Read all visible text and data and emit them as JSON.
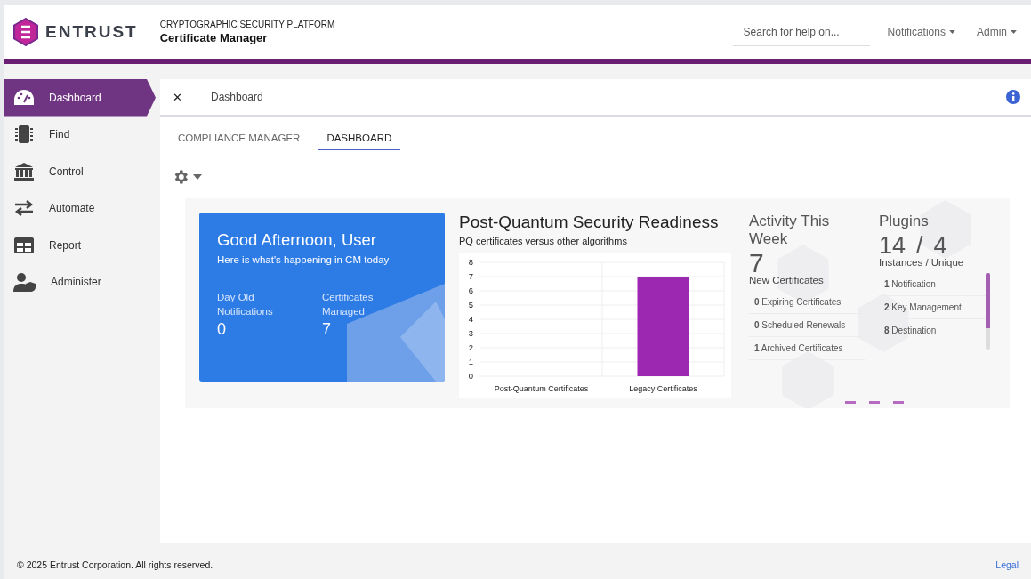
{
  "header": {
    "brand": "ENTRUST",
    "platform": "CRYPTOGRAPHIC SECURITY PLATFORM",
    "product": "Certificate Manager",
    "search": {
      "placeholder": "Search for help on..."
    },
    "menus": [
      "Notifications",
      "Admin"
    ]
  },
  "sidebar": {
    "items": [
      {
        "label": "Dashboard",
        "selected": true
      },
      {
        "label": "Find",
        "selected": false
      },
      {
        "label": "Control",
        "selected": false
      },
      {
        "label": "Automate",
        "selected": false
      },
      {
        "label": "Report",
        "selected": false
      },
      {
        "label": "Administer",
        "selected": false
      }
    ]
  },
  "breadcrumb": {
    "close": "✕",
    "title": "Dashboard"
  },
  "tabs": [
    {
      "label": "COMPLIANCE MANAGER",
      "selected": false
    },
    {
      "label": "DASHBOARD",
      "selected": true
    }
  ],
  "welcome": {
    "title": "Good Afternoon, User",
    "subtitle": "Here is what's happening in CM today",
    "stats": [
      {
        "label": "Day Old Notifications",
        "value": "0"
      },
      {
        "label": "Certificates Managed",
        "value": "7"
      }
    ]
  },
  "readiness": {
    "title": "Post-Quantum Security Readiness",
    "subtitle": "PQ certificates versus other algorithms",
    "chart_data": {
      "type": "bar",
      "categories": [
        "Post-Quantum Certificates",
        "Legacy Certificates"
      ],
      "series": [
        {
          "color": "#9c27b0",
          "values": [
            0,
            7
          ]
        }
      ],
      "grid": true,
      "ylim": [
        0,
        8
      ],
      "yticks": [
        0,
        1,
        2,
        3,
        4,
        5,
        6,
        7,
        8
      ]
    }
  },
  "activity": {
    "title": "Activity This Week",
    "count": "7",
    "count_label": "New Certificates",
    "rows": [
      {
        "count": "0",
        "label": "Expiring Certificates"
      },
      {
        "count": "0",
        "label": "Scheduled Renewals"
      },
      {
        "count": "1",
        "label": "Archived Certificates"
      }
    ]
  },
  "plugins": {
    "title": "Plugins",
    "instances": "14",
    "separator": "/",
    "unique": "4",
    "caption": "Instances / Unique",
    "rows": [
      {
        "count": "1",
        "label": "Notification"
      },
      {
        "count": "2",
        "label": "Key Management"
      },
      {
        "count": "8",
        "label": "Destination"
      }
    ]
  },
  "footer": {
    "copyright": "© 2025 Entrust Corporation. All rights reserved.",
    "legal": "Legal"
  }
}
